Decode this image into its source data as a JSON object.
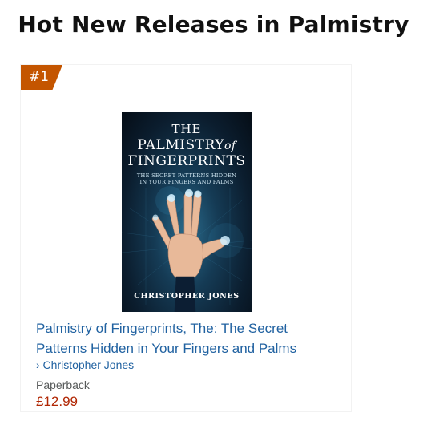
{
  "page": {
    "title": "Hot New Releases in Palmistry"
  },
  "product": {
    "rank": "#1",
    "cover": {
      "line1": "THE",
      "line2_main": "PALMISTRY",
      "line2_italic": "of",
      "line3": "FINGERPRINTS",
      "subtitle": "THE SECRET PATTERNS HIDDEN IN YOUR FINGERS AND PALMS",
      "author": "CHRISTOPHER JONES"
    },
    "title": "Palmistry of Fingerprints, The: The Secret Patterns Hidden in Your Fingers and Palms",
    "author_link": "› Christopher Jones",
    "format": "Paperback",
    "price": "£12.99"
  },
  "colors": {
    "badge": "#c45500",
    "link": "#2162a1",
    "price": "#b12704"
  }
}
